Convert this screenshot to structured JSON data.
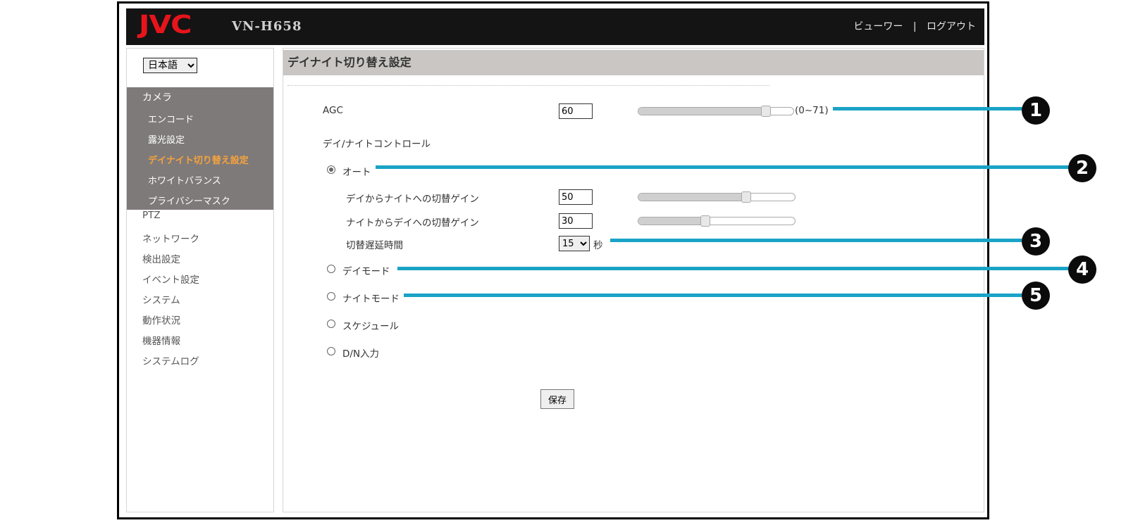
{
  "header": {
    "logo": "JVC",
    "model": "VN-H658",
    "viewer_link": "ビューワー",
    "separator": "|",
    "logout_link": "ログアウト"
  },
  "sidebar": {
    "language": {
      "selected": "日本語",
      "options": [
        "日本語"
      ]
    },
    "camera_section": {
      "title": "カメラ",
      "items": [
        {
          "label": "エンコード",
          "active": false
        },
        {
          "label": "露光設定",
          "active": false
        },
        {
          "label": "デイナイト切り替え設定",
          "active": true
        },
        {
          "label": "ホワイトバランス",
          "active": false
        },
        {
          "label": "プライバシーマスク",
          "active": false
        }
      ]
    },
    "items": [
      "PTZ",
      "ネットワーク",
      "検出設定",
      "イベント設定",
      "システム",
      "動作状況",
      "機器情報",
      "システムログ"
    ]
  },
  "main": {
    "title": "デイナイト切り替え設定",
    "agc": {
      "label": "AGC",
      "value": "60",
      "range_text": "(0~71)",
      "slider_level": 0.845
    },
    "daynight_control_label": "デイ/ナイトコントロール",
    "auto": {
      "label": "オート",
      "checked": true,
      "day_to_night": {
        "label": "デイからナイトへの切替ゲイン",
        "value": "50",
        "slider_level": 0.704
      },
      "night_to_day": {
        "label": "ナイトからデイへの切替ゲイン",
        "value": "30",
        "slider_level": 0.423
      },
      "delay": {
        "label": "切替遅延時間",
        "value": "15",
        "unit": "秒"
      }
    },
    "modes": [
      {
        "label": "デイモード",
        "checked": false
      },
      {
        "label": "ナイトモード",
        "checked": false
      },
      {
        "label": "スケジュール",
        "checked": false
      },
      {
        "label": "D/N入力",
        "checked": false
      }
    ],
    "save_label": "保存"
  },
  "callouts": [
    "1",
    "2",
    "3",
    "4",
    "5"
  ],
  "colors": {
    "accent_active": "#f7a33a",
    "callout_line": "#1aa3c6",
    "logo_red": "#e8141b"
  }
}
